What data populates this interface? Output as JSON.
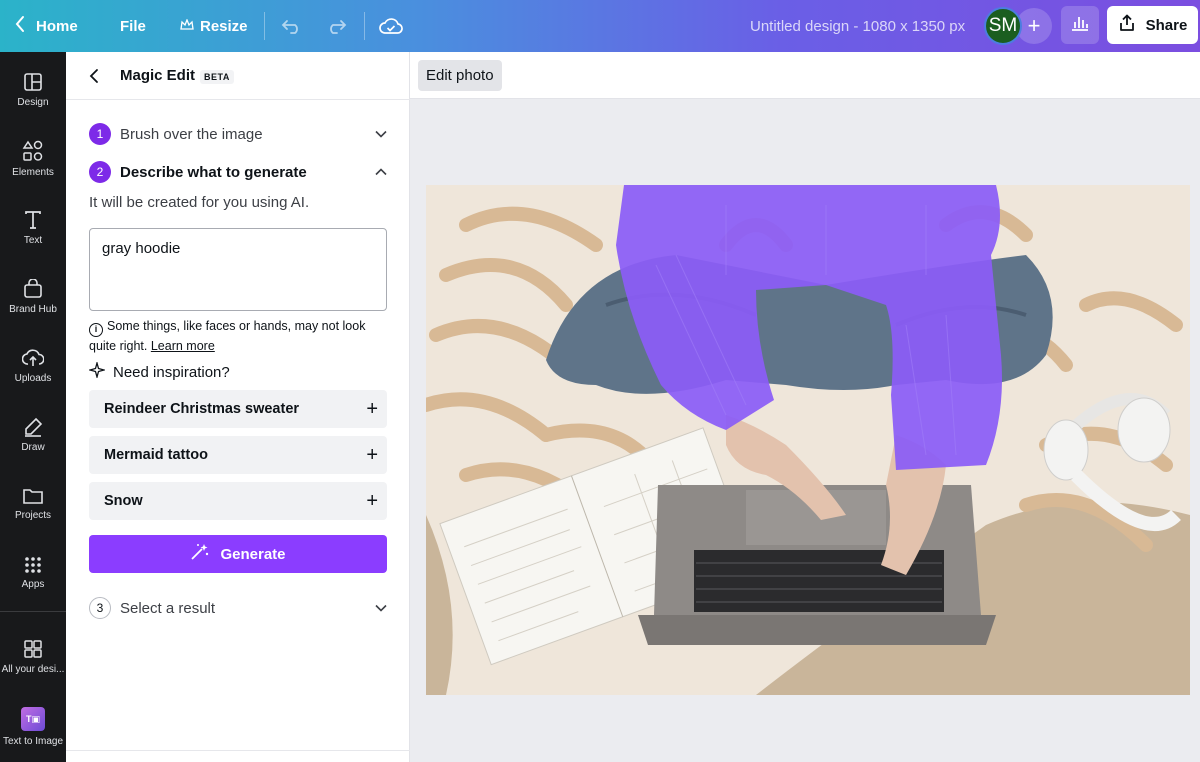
{
  "topbar": {
    "home_label": "Home",
    "file_label": "File",
    "resize_label": "Resize",
    "doc_title": "Untitled design - 1080 x 1350 px",
    "avatar_initials": "SM",
    "add_symbol": "+",
    "share_label": "Share"
  },
  "rail": {
    "items": [
      {
        "label": "Design",
        "icon": "layout-icon"
      },
      {
        "label": "Elements",
        "icon": "shapes-icon"
      },
      {
        "label": "Text",
        "icon": "text-icon"
      },
      {
        "label": "Brand Hub",
        "icon": "brand-hub-icon"
      },
      {
        "label": "Uploads",
        "icon": "cloud-upload-icon"
      },
      {
        "label": "Draw",
        "icon": "pen-icon"
      },
      {
        "label": "Projects",
        "icon": "folder-icon"
      },
      {
        "label": "Apps",
        "icon": "grid-icon"
      },
      {
        "label": "All your desi...",
        "icon": "grid-plus-icon"
      },
      {
        "label": "Text to Image",
        "icon": "text-to-image-icon"
      }
    ]
  },
  "panel": {
    "title": "Magic Edit",
    "badge": "BETA",
    "steps": [
      {
        "num": "1",
        "label": "Brush over the image"
      },
      {
        "num": "2",
        "label": "Describe what to generate"
      },
      {
        "num": "3",
        "label": "Select a result"
      }
    ],
    "subtext": "It will be created for you using AI.",
    "prompt_value": "gray hoodie",
    "disclaimer": "Some things, like faces or hands, may not look quite right.",
    "learn_more": "Learn more",
    "inspiration_label": "Need inspiration?",
    "suggestions": [
      "Reindeer Christmas sweater",
      "Mermaid tattoo",
      "Snow"
    ],
    "generate_label": "Generate",
    "accent_color": "#8b3dff"
  },
  "canvas": {
    "edit_photo_label": "Edit photo",
    "brush_mask_color": "#8b5cf6"
  }
}
